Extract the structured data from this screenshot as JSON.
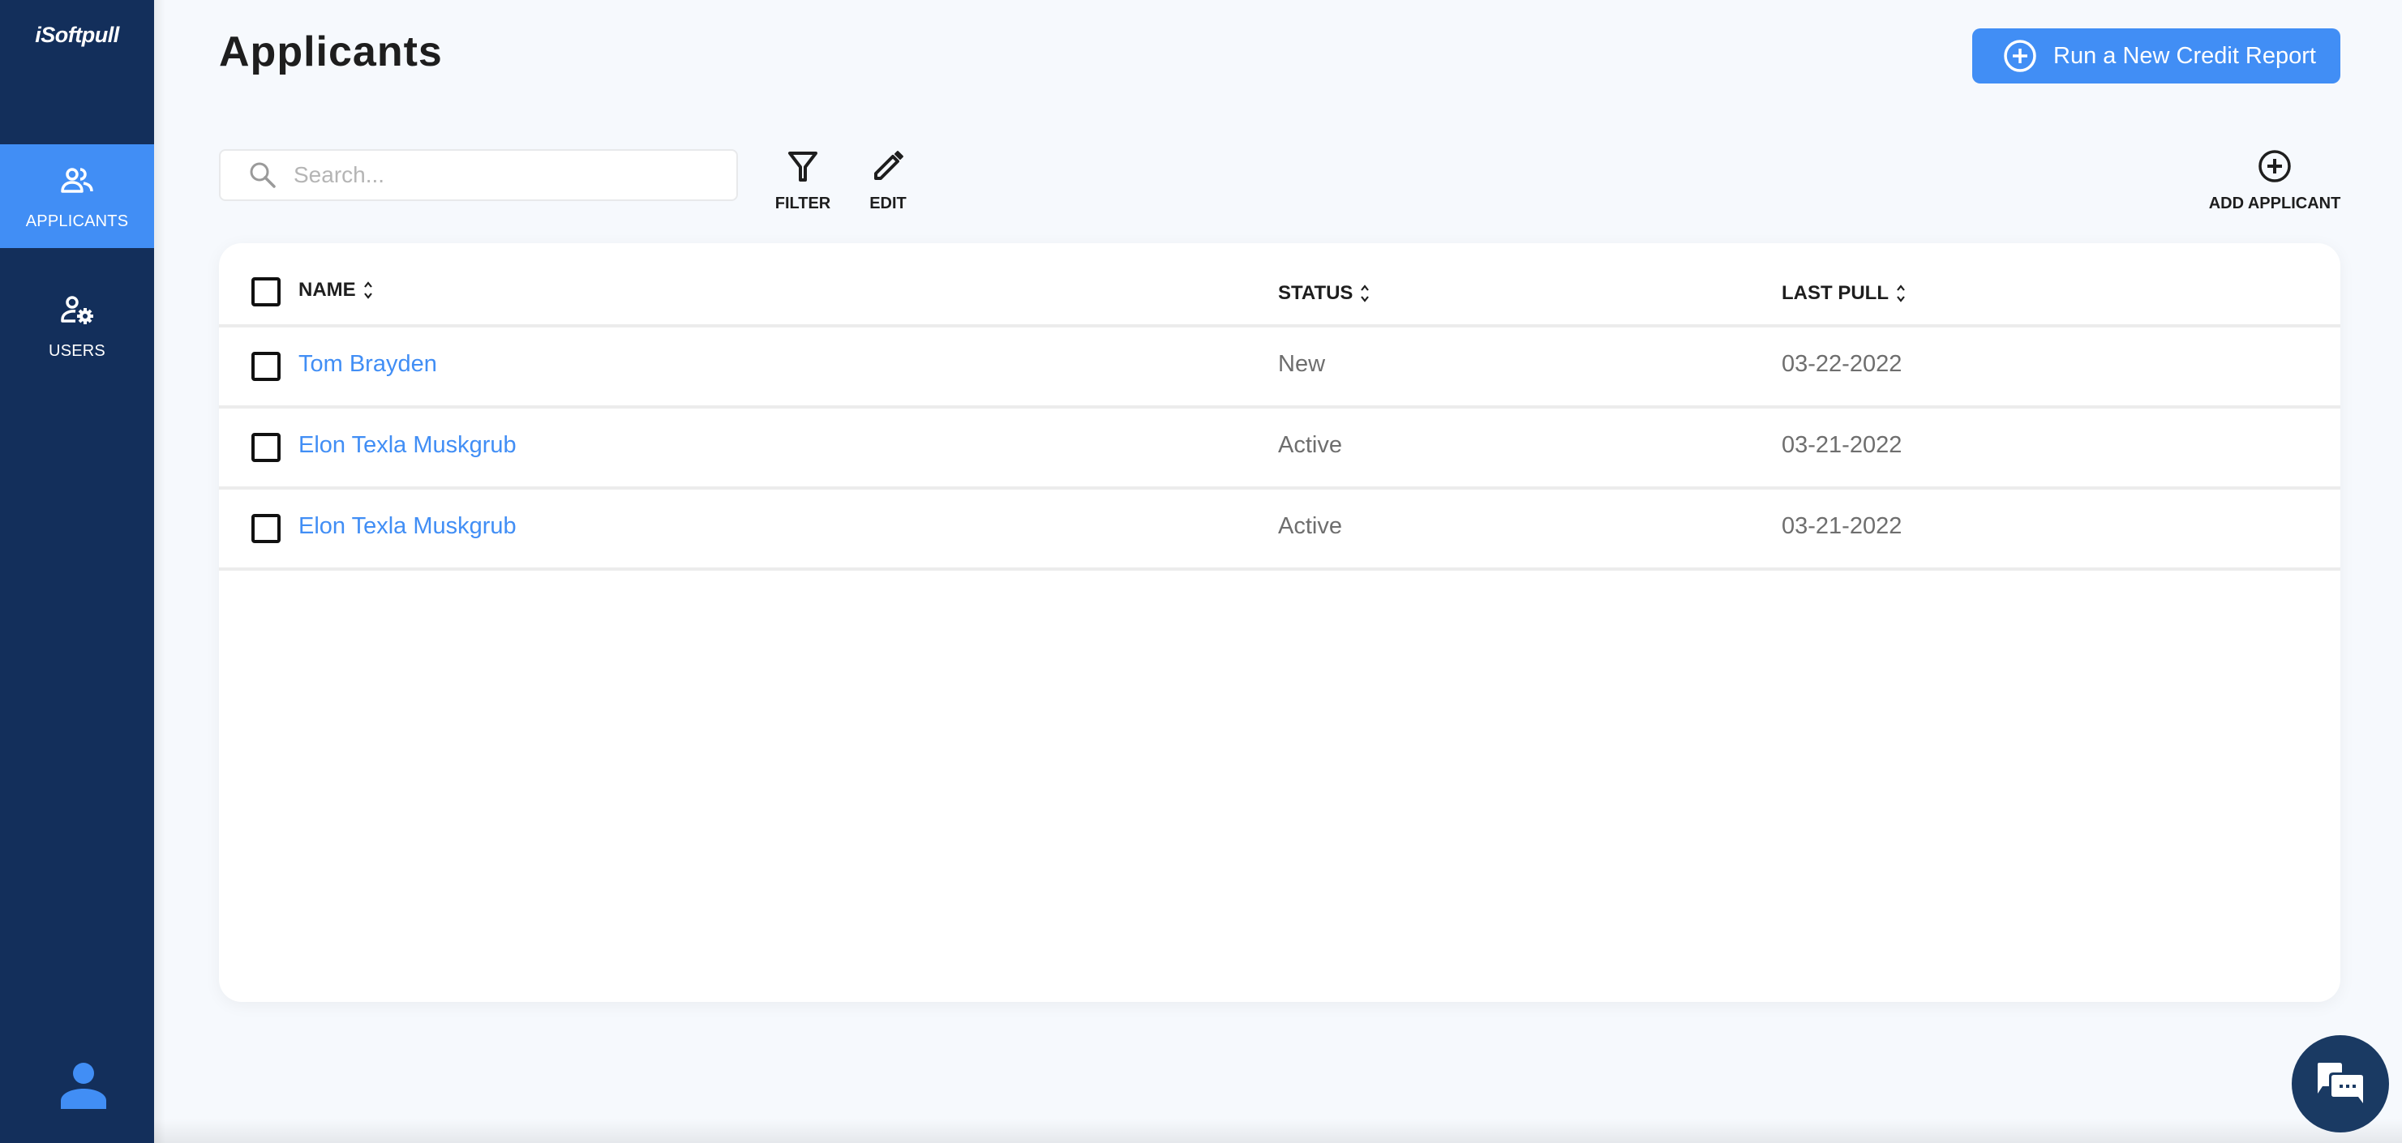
{
  "app": {
    "logo": "iSoftpull"
  },
  "sidebar": {
    "items": [
      {
        "label": "APPLICANTS",
        "icon": "users-icon",
        "active": true
      },
      {
        "label": "USERS",
        "icon": "user-settings-icon",
        "active": false
      }
    ],
    "profile_icon": "account-icon"
  },
  "header": {
    "title": "Applicants",
    "run_report_label": "Run a New Credit Report"
  },
  "toolbar": {
    "search_placeholder": "Search...",
    "search_value": "",
    "filter_label": "FILTER",
    "edit_label": "EDIT",
    "add_label": "ADD APPLICANT"
  },
  "table": {
    "columns": [
      {
        "label": "NAME"
      },
      {
        "label": "STATUS"
      },
      {
        "label": "LAST PULL"
      }
    ],
    "rows": [
      {
        "name": "Tom Brayden",
        "status": "New",
        "last_pull": "03-22-2022"
      },
      {
        "name": "Elon Texla Muskgrub",
        "status": "Active",
        "last_pull": "03-21-2022"
      },
      {
        "name": "Elon Texla Muskgrub",
        "status": "Active",
        "last_pull": "03-21-2022"
      }
    ]
  },
  "colors": {
    "sidebar_bg": "#132f5b",
    "accent": "#418ef5",
    "chat_bg": "#1a3a63"
  }
}
